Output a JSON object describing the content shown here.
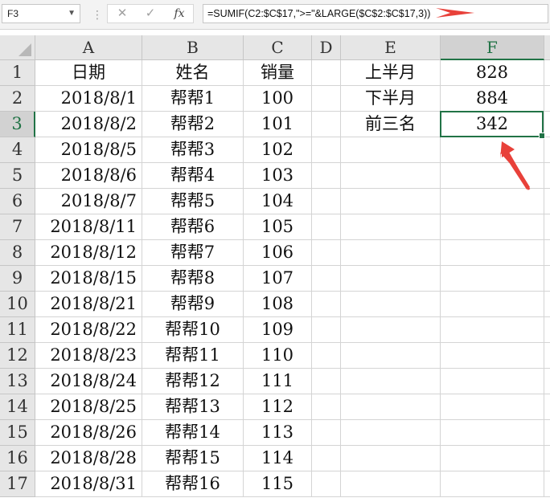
{
  "name_box": "F3",
  "formula": "=SUMIF(C2:$C$17,\">=\"&LARGE($C$2:$C$17,3))",
  "icons": {
    "cancel": "✕",
    "enter": "✓",
    "fx": "fx"
  },
  "columns": [
    "A",
    "B",
    "C",
    "D",
    "E",
    "F"
  ],
  "rows": [
    "1",
    "2",
    "3",
    "4",
    "5",
    "6",
    "7",
    "8",
    "9",
    "10",
    "11",
    "12",
    "13",
    "14",
    "15",
    "16",
    "17"
  ],
  "headers": {
    "date": "日期",
    "name": "姓名",
    "sales": "销量"
  },
  "records": [
    {
      "date": "2018/8/1",
      "name": "帮帮1",
      "sales": "100"
    },
    {
      "date": "2018/8/2",
      "name": "帮帮2",
      "sales": "101"
    },
    {
      "date": "2018/8/5",
      "name": "帮帮3",
      "sales": "102"
    },
    {
      "date": "2018/8/6",
      "name": "帮帮4",
      "sales": "103"
    },
    {
      "date": "2018/8/7",
      "name": "帮帮5",
      "sales": "104"
    },
    {
      "date": "2018/8/11",
      "name": "帮帮6",
      "sales": "105"
    },
    {
      "date": "2018/8/12",
      "name": "帮帮7",
      "sales": "106"
    },
    {
      "date": "2018/8/15",
      "name": "帮帮8",
      "sales": "107"
    },
    {
      "date": "2018/8/21",
      "name": "帮帮9",
      "sales": "108"
    },
    {
      "date": "2018/8/22",
      "name": "帮帮10",
      "sales": "109"
    },
    {
      "date": "2018/8/23",
      "name": "帮帮11",
      "sales": "110"
    },
    {
      "date": "2018/8/24",
      "name": "帮帮12",
      "sales": "111"
    },
    {
      "date": "2018/8/25",
      "name": "帮帮13",
      "sales": "112"
    },
    {
      "date": "2018/8/26",
      "name": "帮帮14",
      "sales": "113"
    },
    {
      "date": "2018/8/28",
      "name": "帮帮15",
      "sales": "114"
    },
    {
      "date": "2018/8/31",
      "name": "帮帮16",
      "sales": "115"
    }
  ],
  "summary": [
    {
      "label": "上半月",
      "value": "828"
    },
    {
      "label": "下半月",
      "value": "884"
    },
    {
      "label": "前三名",
      "value": "342"
    }
  ],
  "selected_cell": {
    "col": "F",
    "row": "3"
  },
  "accent_color": "#217346",
  "annotation_color": "#e8413a"
}
